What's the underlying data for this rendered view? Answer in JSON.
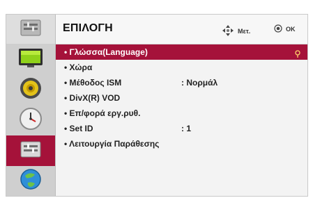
{
  "header": {
    "title": "ΕΠΙΛΟΓΗ",
    "hint_move": "Μετ.",
    "hint_ok": "OK"
  },
  "sidebar": {
    "items": [
      {
        "icon": "settings-tool-icon",
        "selected": false
      },
      {
        "icon": "picture-icon",
        "selected": false
      },
      {
        "icon": "audio-speaker-icon",
        "selected": false
      },
      {
        "icon": "clock-icon",
        "selected": false
      },
      {
        "icon": "option-toolbox-icon",
        "selected": true
      },
      {
        "icon": "network-globe-icon",
        "selected": false
      }
    ]
  },
  "menu": {
    "items": [
      {
        "label": "• Γλώσσα(Language)",
        "value": "",
        "selected": true
      },
      {
        "label": "• Χώρα",
        "value": "",
        "selected": false
      },
      {
        "label": "• Μέθοδος ISM",
        "value": ": Νορμάλ",
        "selected": false
      },
      {
        "label": "• DivX(R) VOD",
        "value": "",
        "selected": false
      },
      {
        "label": "• Επ/φορά εργ.ρυθ.",
        "value": "",
        "selected": false
      },
      {
        "label": "• Set ID",
        "value": ": 1",
        "selected": false
      },
      {
        "label": "• Λειτουργία Παράθεσης",
        "value": "",
        "selected": false
      }
    ]
  },
  "colors": {
    "accent": "#a5123a",
    "sidebar": "#cfcfcf",
    "background": "#f3f3f3"
  }
}
